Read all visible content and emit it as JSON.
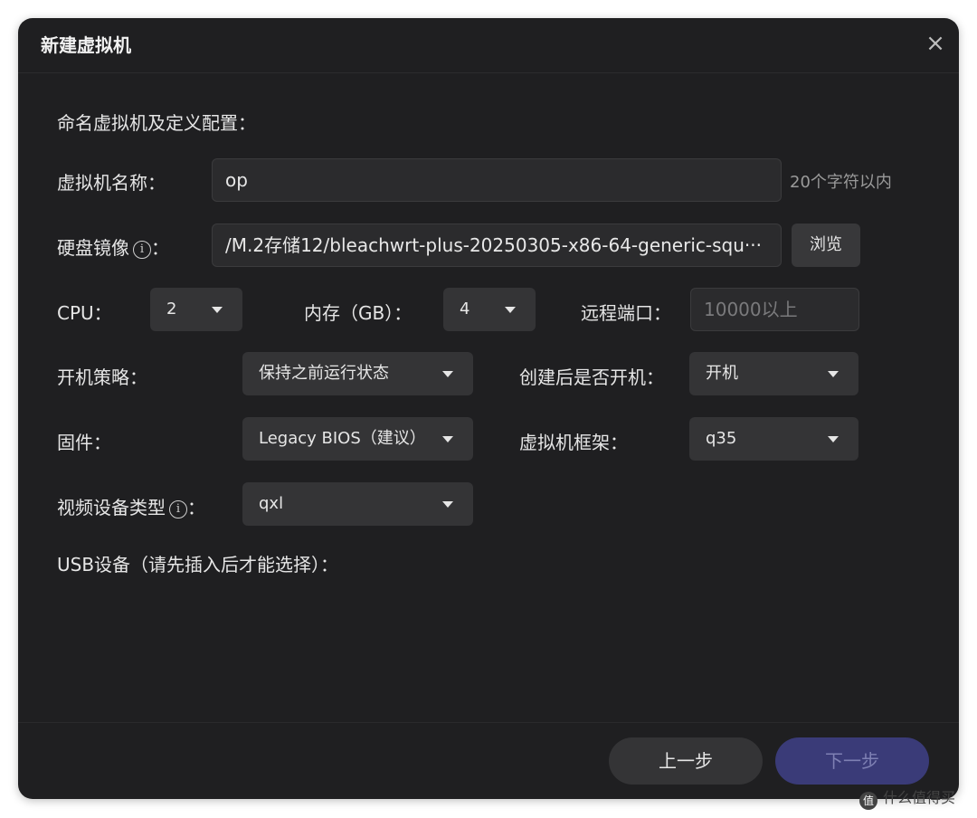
{
  "dialog": {
    "title": "新建虚拟机",
    "close_icon": "×"
  },
  "section": {
    "heading": "命名虚拟机及定义配置："
  },
  "vm_name": {
    "label": "虚拟机名称：",
    "value": "op",
    "hint": "20个字符以内"
  },
  "disk_image": {
    "label": "硬盘镜像",
    "info_icon": "i",
    "colon": "：",
    "value": "/M.2存储12/bleachwrt-plus-20250305-x86-64-generic-squ···",
    "browse_label": "浏览"
  },
  "cpu": {
    "label": "CPU：",
    "value": "2"
  },
  "memory": {
    "label": "内存（GB）：",
    "value": "4"
  },
  "remote_port": {
    "label": "远程端口：",
    "placeholder": "10000以上"
  },
  "power_policy": {
    "label": "开机策略：",
    "value": "保持之前运行状态"
  },
  "power_on_after_create": {
    "label": "创建后是否开机：",
    "value": "开机"
  },
  "firmware": {
    "label": "固件：",
    "value": "Legacy BIOS（建议）"
  },
  "machine_type": {
    "label": "虚拟机框架：",
    "value": "q35"
  },
  "video_device": {
    "label": "视频设备类型",
    "info_icon": "i",
    "colon": "：",
    "value": "qxl"
  },
  "usb": {
    "label": "USB设备（请先插入后才能选择）："
  },
  "footer": {
    "prev_label": "上一步",
    "next_label": "下一步"
  },
  "watermark": {
    "logo": "值",
    "text": "什么值得买"
  },
  "colors": {
    "dialog_bg": "#1f1f21",
    "next_button_bg": "#3a3b78"
  }
}
